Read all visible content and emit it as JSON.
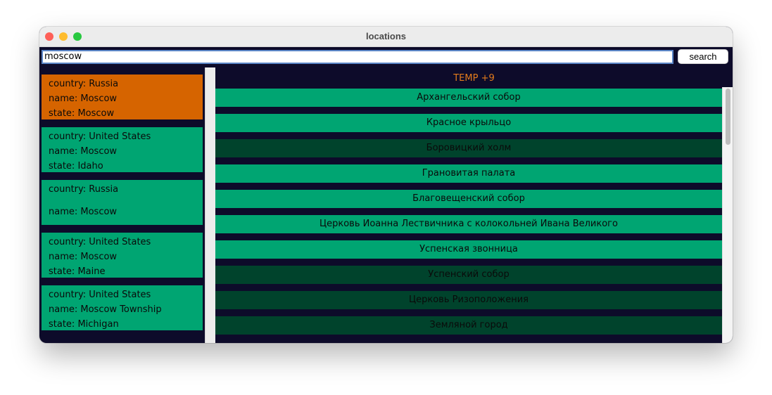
{
  "window": {
    "title": "locations"
  },
  "search": {
    "value": "moscow",
    "button_label": "search"
  },
  "locations": [
    {
      "country": "country: Russia",
      "name": "name: Moscow",
      "state": "state: Moscow",
      "selected": true
    },
    {
      "country": "country: United States",
      "name": "name: Moscow",
      "state": "state: Idaho"
    },
    {
      "country": "country: Russia",
      "name": "name: Moscow"
    },
    {
      "country": "country: United States",
      "name": "name: Moscow",
      "state": "state: Maine"
    },
    {
      "country": "country: United States",
      "name": "name: Moscow Township",
      "state": "state: Michigan"
    }
  ],
  "weather": {
    "temp": "TEMP +9"
  },
  "places": [
    {
      "label": "Архангельский собор",
      "style": "light"
    },
    {
      "label": "Красное крыльцо",
      "style": "light"
    },
    {
      "label": "Боровицкий холм",
      "style": "dark"
    },
    {
      "label": "Грановитая палата",
      "style": "light"
    },
    {
      "label": "Благовещенский собор",
      "style": "light"
    },
    {
      "label": "Церковь Иоанна Лествичника с колокольней Ивана Великого",
      "style": "light"
    },
    {
      "label": "Успенская звонница",
      "style": "light"
    },
    {
      "label": "Успенский собор",
      "style": "dark"
    },
    {
      "label": "Церковь Ризоположения",
      "style": "dark"
    },
    {
      "label": "Земляной город",
      "style": "dark"
    }
  ],
  "colors": {
    "window_bg": "#0d0b2a",
    "card_green": "#00a572",
    "card_selected": "#d66400",
    "row_dark": "#00432c",
    "temp_text": "#e27b1c"
  }
}
